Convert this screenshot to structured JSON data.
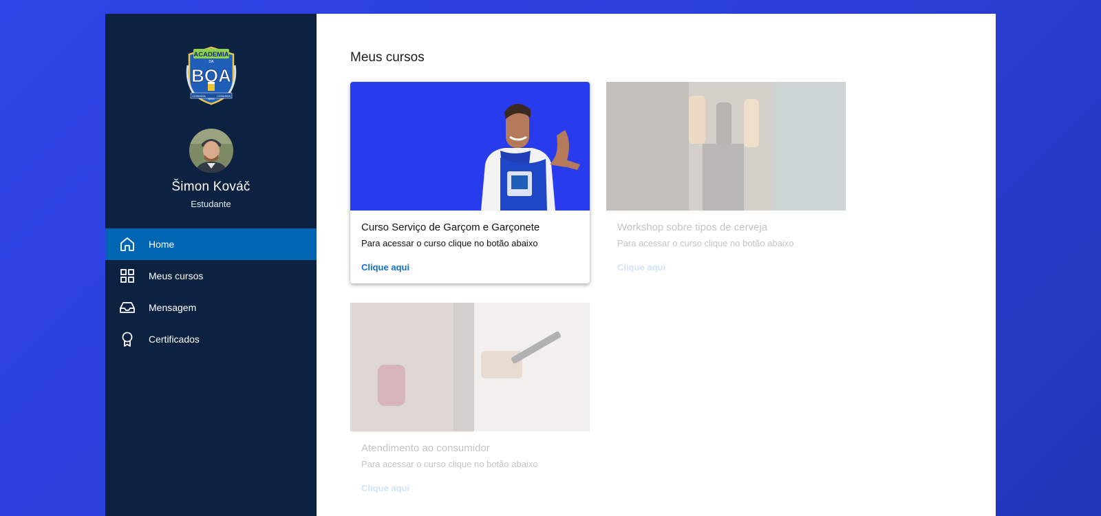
{
  "sidebar": {
    "logo_text": [
      "ACADEMIA",
      "DA",
      "BOA",
      "COISA BOA",
      "BERA",
      "COISA BOA"
    ],
    "user": {
      "name": "Šimon Kováč",
      "role": "Estudante"
    },
    "nav": [
      {
        "label": "Home",
        "icon": "home-icon",
        "active": true
      },
      {
        "label": "Meus cursos",
        "icon": "grid-icon",
        "active": false
      },
      {
        "label": "Mensagem",
        "icon": "inbox-icon",
        "active": false
      },
      {
        "label": "Certificados",
        "icon": "award-icon",
        "active": false
      }
    ]
  },
  "main": {
    "title": "Meus cursos",
    "courses": [
      {
        "title": "Curso Serviço de Garçom e Garçonete",
        "description": "Para acessar o curso clique no botão abaixo",
        "link": "Clique aqui",
        "enabled": true
      },
      {
        "title": "Workshop sobre tipos de cerveja",
        "description": "Para acessar o curso clique no botão abaixo",
        "link": "Clique aqui",
        "enabled": false
      },
      {
        "title": "Atendimento ao consumidor",
        "description": "Para acessar o curso clique no botão abaixo",
        "link": "Clique aqui",
        "enabled": false
      }
    ]
  },
  "colors": {
    "background": "#2f44e6",
    "sidebar": "#0c2240",
    "active_nav": "#0066b3",
    "link": "#0f6fcf"
  }
}
